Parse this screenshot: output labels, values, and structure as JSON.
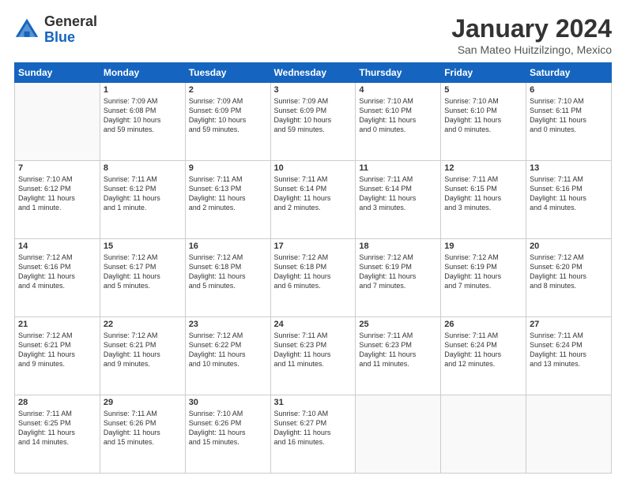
{
  "logo": {
    "general": "General",
    "blue": "Blue"
  },
  "title": {
    "month_year": "January 2024",
    "location": "San Mateo Huitzilzingo, Mexico"
  },
  "days_of_week": [
    "Sunday",
    "Monday",
    "Tuesday",
    "Wednesday",
    "Thursday",
    "Friday",
    "Saturday"
  ],
  "weeks": [
    [
      {
        "day": "",
        "info": ""
      },
      {
        "day": "1",
        "info": "Sunrise: 7:09 AM\nSunset: 6:08 PM\nDaylight: 10 hours\nand 59 minutes."
      },
      {
        "day": "2",
        "info": "Sunrise: 7:09 AM\nSunset: 6:09 PM\nDaylight: 10 hours\nand 59 minutes."
      },
      {
        "day": "3",
        "info": "Sunrise: 7:09 AM\nSunset: 6:09 PM\nDaylight: 10 hours\nand 59 minutes."
      },
      {
        "day": "4",
        "info": "Sunrise: 7:10 AM\nSunset: 6:10 PM\nDaylight: 11 hours\nand 0 minutes."
      },
      {
        "day": "5",
        "info": "Sunrise: 7:10 AM\nSunset: 6:10 PM\nDaylight: 11 hours\nand 0 minutes."
      },
      {
        "day": "6",
        "info": "Sunrise: 7:10 AM\nSunset: 6:11 PM\nDaylight: 11 hours\nand 0 minutes."
      }
    ],
    [
      {
        "day": "7",
        "info": "Sunrise: 7:10 AM\nSunset: 6:12 PM\nDaylight: 11 hours\nand 1 minute."
      },
      {
        "day": "8",
        "info": "Sunrise: 7:11 AM\nSunset: 6:12 PM\nDaylight: 11 hours\nand 1 minute."
      },
      {
        "day": "9",
        "info": "Sunrise: 7:11 AM\nSunset: 6:13 PM\nDaylight: 11 hours\nand 2 minutes."
      },
      {
        "day": "10",
        "info": "Sunrise: 7:11 AM\nSunset: 6:14 PM\nDaylight: 11 hours\nand 2 minutes."
      },
      {
        "day": "11",
        "info": "Sunrise: 7:11 AM\nSunset: 6:14 PM\nDaylight: 11 hours\nand 3 minutes."
      },
      {
        "day": "12",
        "info": "Sunrise: 7:11 AM\nSunset: 6:15 PM\nDaylight: 11 hours\nand 3 minutes."
      },
      {
        "day": "13",
        "info": "Sunrise: 7:11 AM\nSunset: 6:16 PM\nDaylight: 11 hours\nand 4 minutes."
      }
    ],
    [
      {
        "day": "14",
        "info": "Sunrise: 7:12 AM\nSunset: 6:16 PM\nDaylight: 11 hours\nand 4 minutes."
      },
      {
        "day": "15",
        "info": "Sunrise: 7:12 AM\nSunset: 6:17 PM\nDaylight: 11 hours\nand 5 minutes."
      },
      {
        "day": "16",
        "info": "Sunrise: 7:12 AM\nSunset: 6:18 PM\nDaylight: 11 hours\nand 5 minutes."
      },
      {
        "day": "17",
        "info": "Sunrise: 7:12 AM\nSunset: 6:18 PM\nDaylight: 11 hours\nand 6 minutes."
      },
      {
        "day": "18",
        "info": "Sunrise: 7:12 AM\nSunset: 6:19 PM\nDaylight: 11 hours\nand 7 minutes."
      },
      {
        "day": "19",
        "info": "Sunrise: 7:12 AM\nSunset: 6:19 PM\nDaylight: 11 hours\nand 7 minutes."
      },
      {
        "day": "20",
        "info": "Sunrise: 7:12 AM\nSunset: 6:20 PM\nDaylight: 11 hours\nand 8 minutes."
      }
    ],
    [
      {
        "day": "21",
        "info": "Sunrise: 7:12 AM\nSunset: 6:21 PM\nDaylight: 11 hours\nand 9 minutes."
      },
      {
        "day": "22",
        "info": "Sunrise: 7:12 AM\nSunset: 6:21 PM\nDaylight: 11 hours\nand 9 minutes."
      },
      {
        "day": "23",
        "info": "Sunrise: 7:12 AM\nSunset: 6:22 PM\nDaylight: 11 hours\nand 10 minutes."
      },
      {
        "day": "24",
        "info": "Sunrise: 7:11 AM\nSunset: 6:23 PM\nDaylight: 11 hours\nand 11 minutes."
      },
      {
        "day": "25",
        "info": "Sunrise: 7:11 AM\nSunset: 6:23 PM\nDaylight: 11 hours\nand 11 minutes."
      },
      {
        "day": "26",
        "info": "Sunrise: 7:11 AM\nSunset: 6:24 PM\nDaylight: 11 hours\nand 12 minutes."
      },
      {
        "day": "27",
        "info": "Sunrise: 7:11 AM\nSunset: 6:24 PM\nDaylight: 11 hours\nand 13 minutes."
      }
    ],
    [
      {
        "day": "28",
        "info": "Sunrise: 7:11 AM\nSunset: 6:25 PM\nDaylight: 11 hours\nand 14 minutes."
      },
      {
        "day": "29",
        "info": "Sunrise: 7:11 AM\nSunset: 6:26 PM\nDaylight: 11 hours\nand 15 minutes."
      },
      {
        "day": "30",
        "info": "Sunrise: 7:10 AM\nSunset: 6:26 PM\nDaylight: 11 hours\nand 15 minutes."
      },
      {
        "day": "31",
        "info": "Sunrise: 7:10 AM\nSunset: 6:27 PM\nDaylight: 11 hours\nand 16 minutes."
      },
      {
        "day": "",
        "info": ""
      },
      {
        "day": "",
        "info": ""
      },
      {
        "day": "",
        "info": ""
      }
    ]
  ]
}
